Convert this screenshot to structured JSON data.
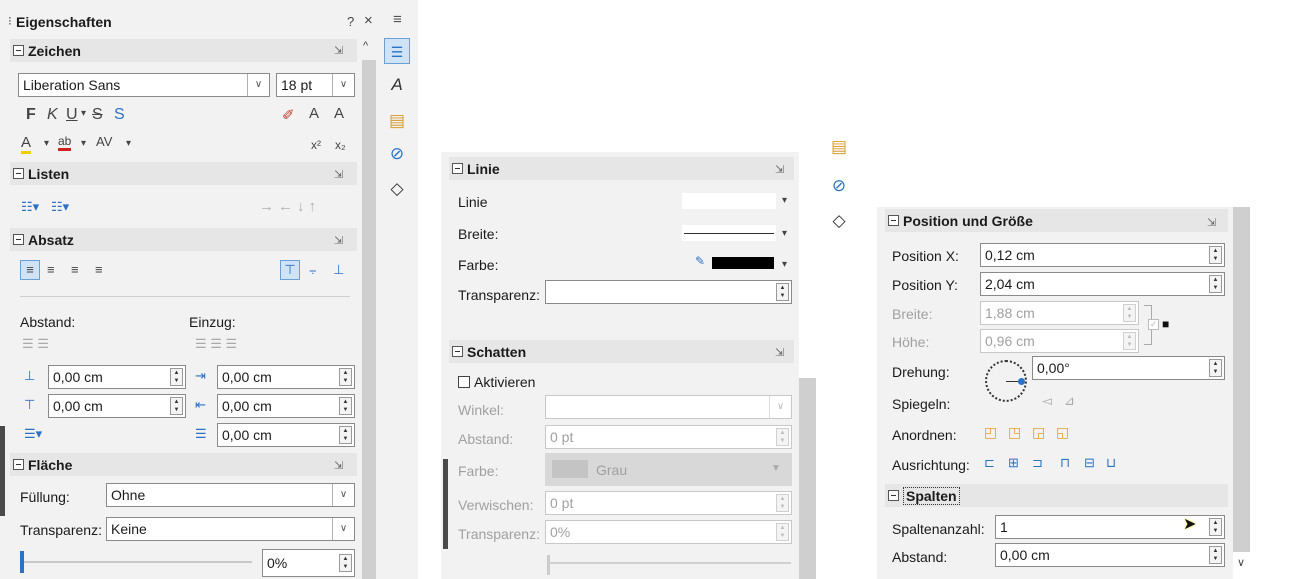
{
  "panel1": {
    "title": "Eigenschaften",
    "help_glyph": "?",
    "close_glyph": "×",
    "menu_glyph": "≡",
    "zeichen": {
      "header": "Zeichen",
      "font_name": "Liberation Sans",
      "font_size": "18 pt",
      "bold": "F",
      "italic": "K",
      "underline": "U",
      "strike": "S",
      "shadow": "S",
      "superscript": "x²",
      "subscript": "x₂"
    },
    "listen": {
      "header": "Listen"
    },
    "absatz": {
      "header": "Absatz",
      "abstand_label": "Abstand:",
      "einzug_label": "Einzug:",
      "above": "0,00 cm",
      "below": "0,00 cm",
      "indent_before": "0,00 cm",
      "indent_after": "0,00 cm",
      "first_line": "0,00 cm"
    },
    "flaeche": {
      "header": "Fläche",
      "fill_label": "Füllung:",
      "fill_value": "Ohne",
      "transp_label": "Transparenz:",
      "transp_value": "Keine",
      "transp_percent": "0%"
    }
  },
  "panel2": {
    "linie": {
      "header": "Linie",
      "line_label": "Linie",
      "width_label": "Breite:",
      "color_label": "Farbe:",
      "transp_label": "Transparenz:"
    },
    "schatten": {
      "header": "Schatten",
      "activate": "Aktivieren",
      "angle_label": "Winkel:",
      "distance_label": "Abstand:",
      "distance_value": "0 pt",
      "color_label": "Farbe:",
      "color_value": "Grau",
      "blur_label": "Verwischen:",
      "blur_value": "0 pt",
      "transp_label": "Transparenz:",
      "transp_value": "0%"
    }
  },
  "panel3": {
    "posgr": {
      "header": "Position und Größe",
      "posx_label": "Position X:",
      "posx_value": "0,12 cm",
      "posy_label": "Position Y:",
      "posy_value": "2,04 cm",
      "width_label": "Breite:",
      "width_value": "1,88 cm",
      "height_label": "Höhe:",
      "height_value": "0,96 cm",
      "rotation_label": "Drehung:",
      "rotation_value": "0,00°",
      "mirror_label": "Spiegeln:",
      "arrange_label": "Anordnen:",
      "align_label": "Ausrichtung:"
    },
    "spalten": {
      "header": "Spalten",
      "count_label": "Spaltenanzahl:",
      "count_value": "1",
      "spacing_label": "Abstand:",
      "spacing_value": "0,00 cm"
    }
  },
  "colors": {
    "accent": "#2a72c8",
    "header_bg": "#e6e6e6",
    "panel_bg": "#f2f2f2"
  }
}
